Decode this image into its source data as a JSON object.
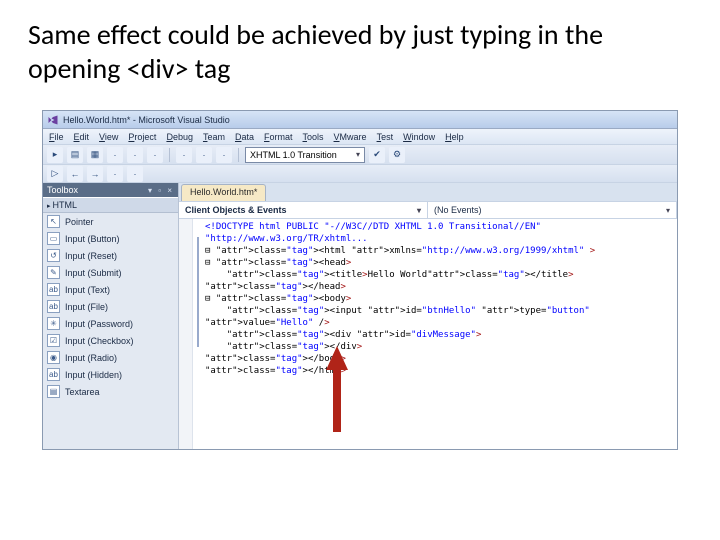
{
  "headline": "Same effect could be achieved by just typing in the opening <div> tag",
  "window_title": "Hello.World.htm* - Microsoft Visual Studio",
  "menu": [
    "File",
    "Edit",
    "View",
    "Project",
    "Debug",
    "Team",
    "Data",
    "Format",
    "Tools",
    "VMware",
    "Test",
    "Window",
    "Help"
  ],
  "doctype_dropdown": "XHTML 1.0 Transition",
  "doc_tab": "Hello.World.htm*",
  "dd_left": "Client Objects & Events",
  "dd_right": "(No Events)",
  "toolbox": {
    "title": "Toolbox",
    "controls": "▾ ▫ ×",
    "category": "HTML",
    "items": [
      {
        "icon": "↖",
        "label": "Pointer"
      },
      {
        "icon": "▭",
        "label": "Input (Button)"
      },
      {
        "icon": "↺",
        "label": "Input (Reset)"
      },
      {
        "icon": "✎",
        "label": "Input (Submit)"
      },
      {
        "icon": "ab",
        "label": "Input (Text)"
      },
      {
        "icon": "ab",
        "label": "Input (File)"
      },
      {
        "icon": "✳",
        "label": "Input (Password)"
      },
      {
        "icon": "☑",
        "label": "Input (Checkbox)"
      },
      {
        "icon": "◉",
        "label": "Input (Radio)"
      },
      {
        "icon": "ab",
        "label": "Input (Hidden)"
      },
      {
        "icon": "▤",
        "label": "Textarea"
      }
    ]
  },
  "toolbar_icons": [
    "▸",
    "▤",
    "▦",
    "·",
    "·",
    "·",
    "|",
    "·",
    "·",
    "·"
  ],
  "toolbar2_icons": [
    "▷",
    "←",
    "→",
    "·",
    "·"
  ],
  "code_lines": [
    {
      "t": "doctype",
      "text": "<!DOCTYPE html PUBLIC \"-//W3C//DTD XHTML 1.0 Transitional//EN\" \"http://www.w3.org/TR/xhtml..."
    },
    {
      "t": "open",
      "indent": 0,
      "tag": "html",
      "attrs": " xmlns=\"http://www.w3.org/1999/xhtml\" >"
    },
    {
      "t": "open",
      "indent": 0,
      "tag": "head",
      "attrs": ">"
    },
    {
      "t": "line",
      "indent": 1,
      "html": "<title>Hello World</title>"
    },
    {
      "t": "close",
      "indent": 0,
      "tag": "head"
    },
    {
      "t": "open",
      "indent": 0,
      "tag": "body",
      "attrs": ">"
    },
    {
      "t": "line",
      "indent": 1,
      "html": "<input id=\"btnHello\" type=\"button\" value=\"Hello\" />"
    },
    {
      "t": "line",
      "indent": 1,
      "html": "<div id=\"divMessage\">"
    },
    {
      "t": "close",
      "indent": 1,
      "tag": "div"
    },
    {
      "t": "close",
      "indent": 0,
      "tag": "body"
    },
    {
      "t": "close",
      "indent": 0,
      "tag": "html"
    }
  ]
}
